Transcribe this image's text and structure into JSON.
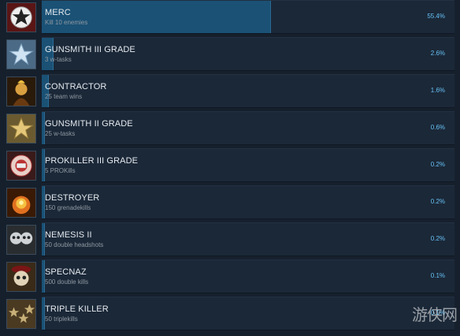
{
  "achievements": [
    {
      "name": "MERC",
      "desc": "Kill 10 enemies",
      "pct": "55.4%",
      "value": 55.4,
      "icon": "star-icon"
    },
    {
      "name": "GUNSMITH III GRADE",
      "desc": "3 w-tasks",
      "pct": "2.6%",
      "value": 2.6,
      "icon": "silver-star-icon"
    },
    {
      "name": "CONTRACTOR",
      "desc": "25 team wins",
      "pct": "1.6%",
      "value": 1.6,
      "icon": "soldier-fire-icon"
    },
    {
      "name": "GUNSMITH II GRADE",
      "desc": "25 w-tasks",
      "pct": "0.6%",
      "value": 0.6,
      "icon": "gold-star-icon"
    },
    {
      "name": "PROKILLER III GRADE",
      "desc": "5 PROKills",
      "pct": "0.2%",
      "value": 0.2,
      "icon": "prokiller-emblem-icon"
    },
    {
      "name": "DESTROYER",
      "desc": "150 grenadekills",
      "pct": "0.2%",
      "value": 0.2,
      "icon": "explosion-icon"
    },
    {
      "name": "NEMESIS II",
      "desc": "50 double headshots",
      "pct": "0.2%",
      "value": 0.2,
      "icon": "twin-skulls-icon"
    },
    {
      "name": "SPECNAZ",
      "desc": "500 double kills",
      "pct": "0.1%",
      "value": 0.1,
      "icon": "skull-beret-icon"
    },
    {
      "name": "TRIPLE KILLER",
      "desc": "50 triplekills",
      "pct": "0.1%",
      "value": 0.1,
      "icon": "triple-stars-icon"
    }
  ],
  "watermark": "游侠网"
}
